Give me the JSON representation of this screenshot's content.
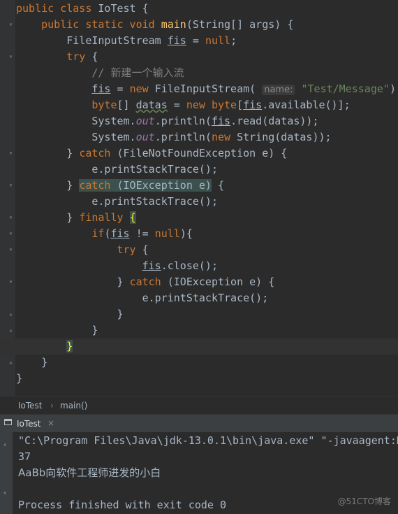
{
  "editor": {
    "lines": [
      {
        "code": "public class IoTest {"
      },
      {
        "code": "    public static void main(String[] args) {"
      },
      {
        "code": "        FileInputStream fis = null;"
      },
      {
        "code": "        try {"
      },
      {
        "code": "            // 新建一个输入流"
      },
      {
        "code": "            fis = new FileInputStream( name: \"Test/Message\");"
      },
      {
        "code": "            byte[] datas = new byte[fis.available()];"
      },
      {
        "code": "            System.out.println(fis.read(datas));"
      },
      {
        "code": "            System.out.println(new String(datas));"
      },
      {
        "code": "        } catch (FileNotFoundException e) {"
      },
      {
        "code": "            e.printStackTrace();"
      },
      {
        "code": "        } catch (IOException e) {"
      },
      {
        "code": "            e.printStackTrace();"
      },
      {
        "code": "        } finally {"
      },
      {
        "code": "            if(fis != null){"
      },
      {
        "code": "                try {"
      },
      {
        "code": "                    fis.close();"
      },
      {
        "code": "                } catch (IOException e) {"
      },
      {
        "code": "                    e.printStackTrace();"
      },
      {
        "code": "                }"
      },
      {
        "code": "            }"
      },
      {
        "code": "        }"
      },
      {
        "code": "    }"
      },
      {
        "code": "}"
      }
    ]
  },
  "breadcrumb": {
    "class_name": "IoTest",
    "separator": "›",
    "method_name": "main()"
  },
  "run_tab": {
    "label": "IoTest",
    "close": "×"
  },
  "console": {
    "lines": [
      "\"C:\\Program Files\\Java\\jdk-13.0.1\\bin\\java.exe\" \"-javaagent:D",
      "37",
      "AaBb向软件工程师进发的小白",
      "",
      "Process finished with exit code 0"
    ]
  },
  "watermark": "@51CTO博客",
  "colors": {
    "background": "#2b2b2b",
    "keyword": "#cc7832",
    "string": "#6a8759",
    "function": "#ffc66d",
    "text": "#a9b7c6"
  }
}
